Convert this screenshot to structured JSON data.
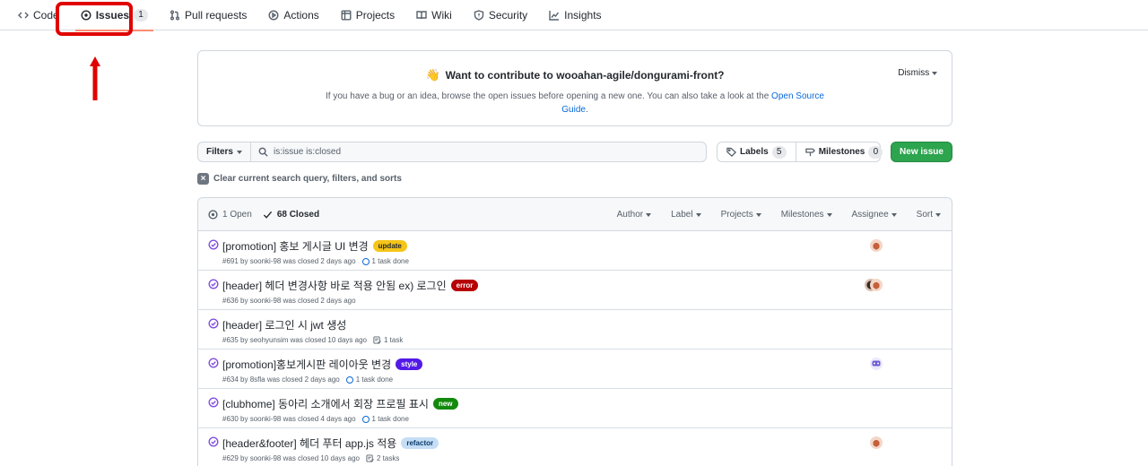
{
  "nav": {
    "code": "Code",
    "issues": "Issues",
    "issues_count": "1",
    "pulls": "Pull requests",
    "actions": "Actions",
    "projects": "Projects",
    "wiki": "Wiki",
    "security": "Security",
    "insights": "Insights"
  },
  "banner": {
    "title": "Want to contribute to wooahan-agile/dongurami-front?",
    "text": "If you have a bug or an idea, browse the open issues before opening a new one. You can also take a look at the",
    "link": "Open Source Guide",
    "dismiss": "Dismiss"
  },
  "toolbar": {
    "filters": "Filters",
    "search_value": "is:issue is:closed",
    "labels": "Labels",
    "labels_count": "5",
    "milestones": "Milestones",
    "milestones_count": "0",
    "new_issue": "New issue",
    "clear": "Clear current search query, filters, and sorts"
  },
  "header": {
    "open": "1 Open",
    "closed": "68 Closed",
    "author": "Author",
    "label": "Label",
    "projects": "Projects",
    "milestones": "Milestones",
    "assignee": "Assignee",
    "sort": "Sort"
  },
  "issues": [
    {
      "title": "[promotion] 홍보 게시글 UI 변경",
      "label": "update",
      "label_bg": "#f5c518",
      "label_fg": "#24292f",
      "meta": "#691 by soonki-98 was closed 2 days ago",
      "task": "1 task done",
      "task_type": "done",
      "avatar": "orange"
    },
    {
      "title": "[header] 헤더 변경사항 바로 적용 안됨 ex) 로그인",
      "label": "error",
      "label_bg": "#b60205",
      "label_fg": "#ffffff",
      "meta": "#636 by soonki-98 was closed 2 days ago",
      "task": "",
      "task_type": "none",
      "avatar": "double"
    },
    {
      "title": "[header] 로그인 시 jwt 생성",
      "label": "",
      "label_bg": "",
      "label_fg": "",
      "meta": "#635 by seohyunsim was closed 10 days ago",
      "task": "1 task",
      "task_type": "list",
      "avatar": "none"
    },
    {
      "title": "[promotion]홍보게시판 레이아웃 변경",
      "label": "style",
      "label_bg": "#5319e7",
      "label_fg": "#ffffff",
      "meta": "#634 by 8sfla was closed 2 days ago",
      "task": "1 task done",
      "task_type": "done",
      "avatar": "purple"
    },
    {
      "title": "[clubhome] 동아리 소개에서 회장 프로필 표시",
      "label": "new",
      "label_bg": "#128a0c",
      "label_fg": "#ffffff",
      "meta": "#630 by soonki-98 was closed 4 days ago",
      "task": "1 task done",
      "task_type": "done",
      "avatar": "none"
    },
    {
      "title": "[header&footer] 헤더 푸터 app.js 적용",
      "label": "refactor",
      "label_bg": "#c5def5",
      "label_fg": "#0b3b6b",
      "meta": "#629 by soonki-98 was closed 10 days ago",
      "task": "2 tasks",
      "task_type": "list",
      "avatar": "orange"
    }
  ]
}
